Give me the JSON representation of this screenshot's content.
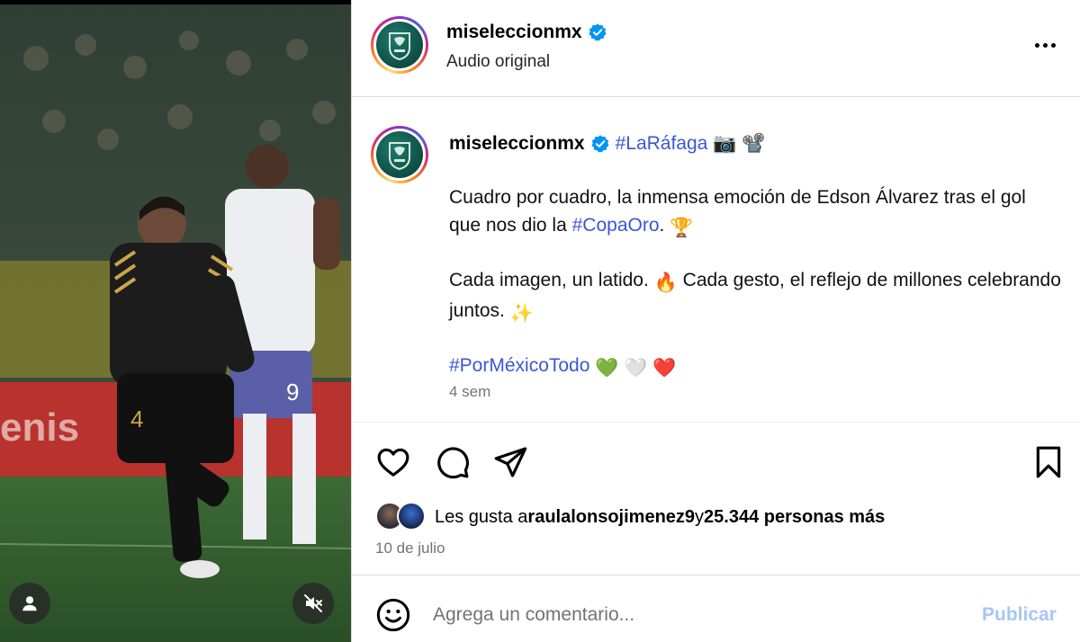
{
  "header": {
    "username": "miseleccionmx",
    "subtitle": "Audio original",
    "more_icon": "more-horizontal-icon"
  },
  "caption": {
    "username": "miseleccionmx",
    "hashtag_title": "#LaRáfaga",
    "title_emojis": "📷 📽️",
    "para1_text": "Cuadro por cuadro, la inmensa emoción de Edson Álvarez tras el gol que nos dio la ",
    "para1_tag": "#CopaOro",
    "para1_end": ". ",
    "para1_emoji": "🏆",
    "para2_text1": "Cada imagen, un latido. ",
    "para2_emoji1": "🔥",
    "para2_text2": " Cada gesto, el reflejo de millones celebrando juntos. ",
    "para2_emoji2": "✨",
    "para3_tag": "#PorMéxicoTodo",
    "para3_emojis": "💚 🤍 ❤️",
    "time_ago": "4 sem"
  },
  "actions": {
    "like_icon": "heart-icon",
    "comment_icon": "comment-icon",
    "share_icon": "send-icon",
    "save_icon": "bookmark-icon"
  },
  "likes": {
    "prefix": "Les gusta a ",
    "user": "raulalonsojimenez9",
    "middle": " y ",
    "count_text": "25.344 personas más"
  },
  "date": "10 de julio",
  "comment": {
    "placeholder": "Agrega un comentario...",
    "publish_label": "Publicar"
  },
  "media": {
    "user_tag_icon": "user-icon",
    "mute_icon": "volume-muted-icon"
  },
  "colors": {
    "link": "#3a57d6",
    "verified": "#0095f6",
    "publish_disabled": "#a6c7f4",
    "muted_text": "#737373"
  }
}
